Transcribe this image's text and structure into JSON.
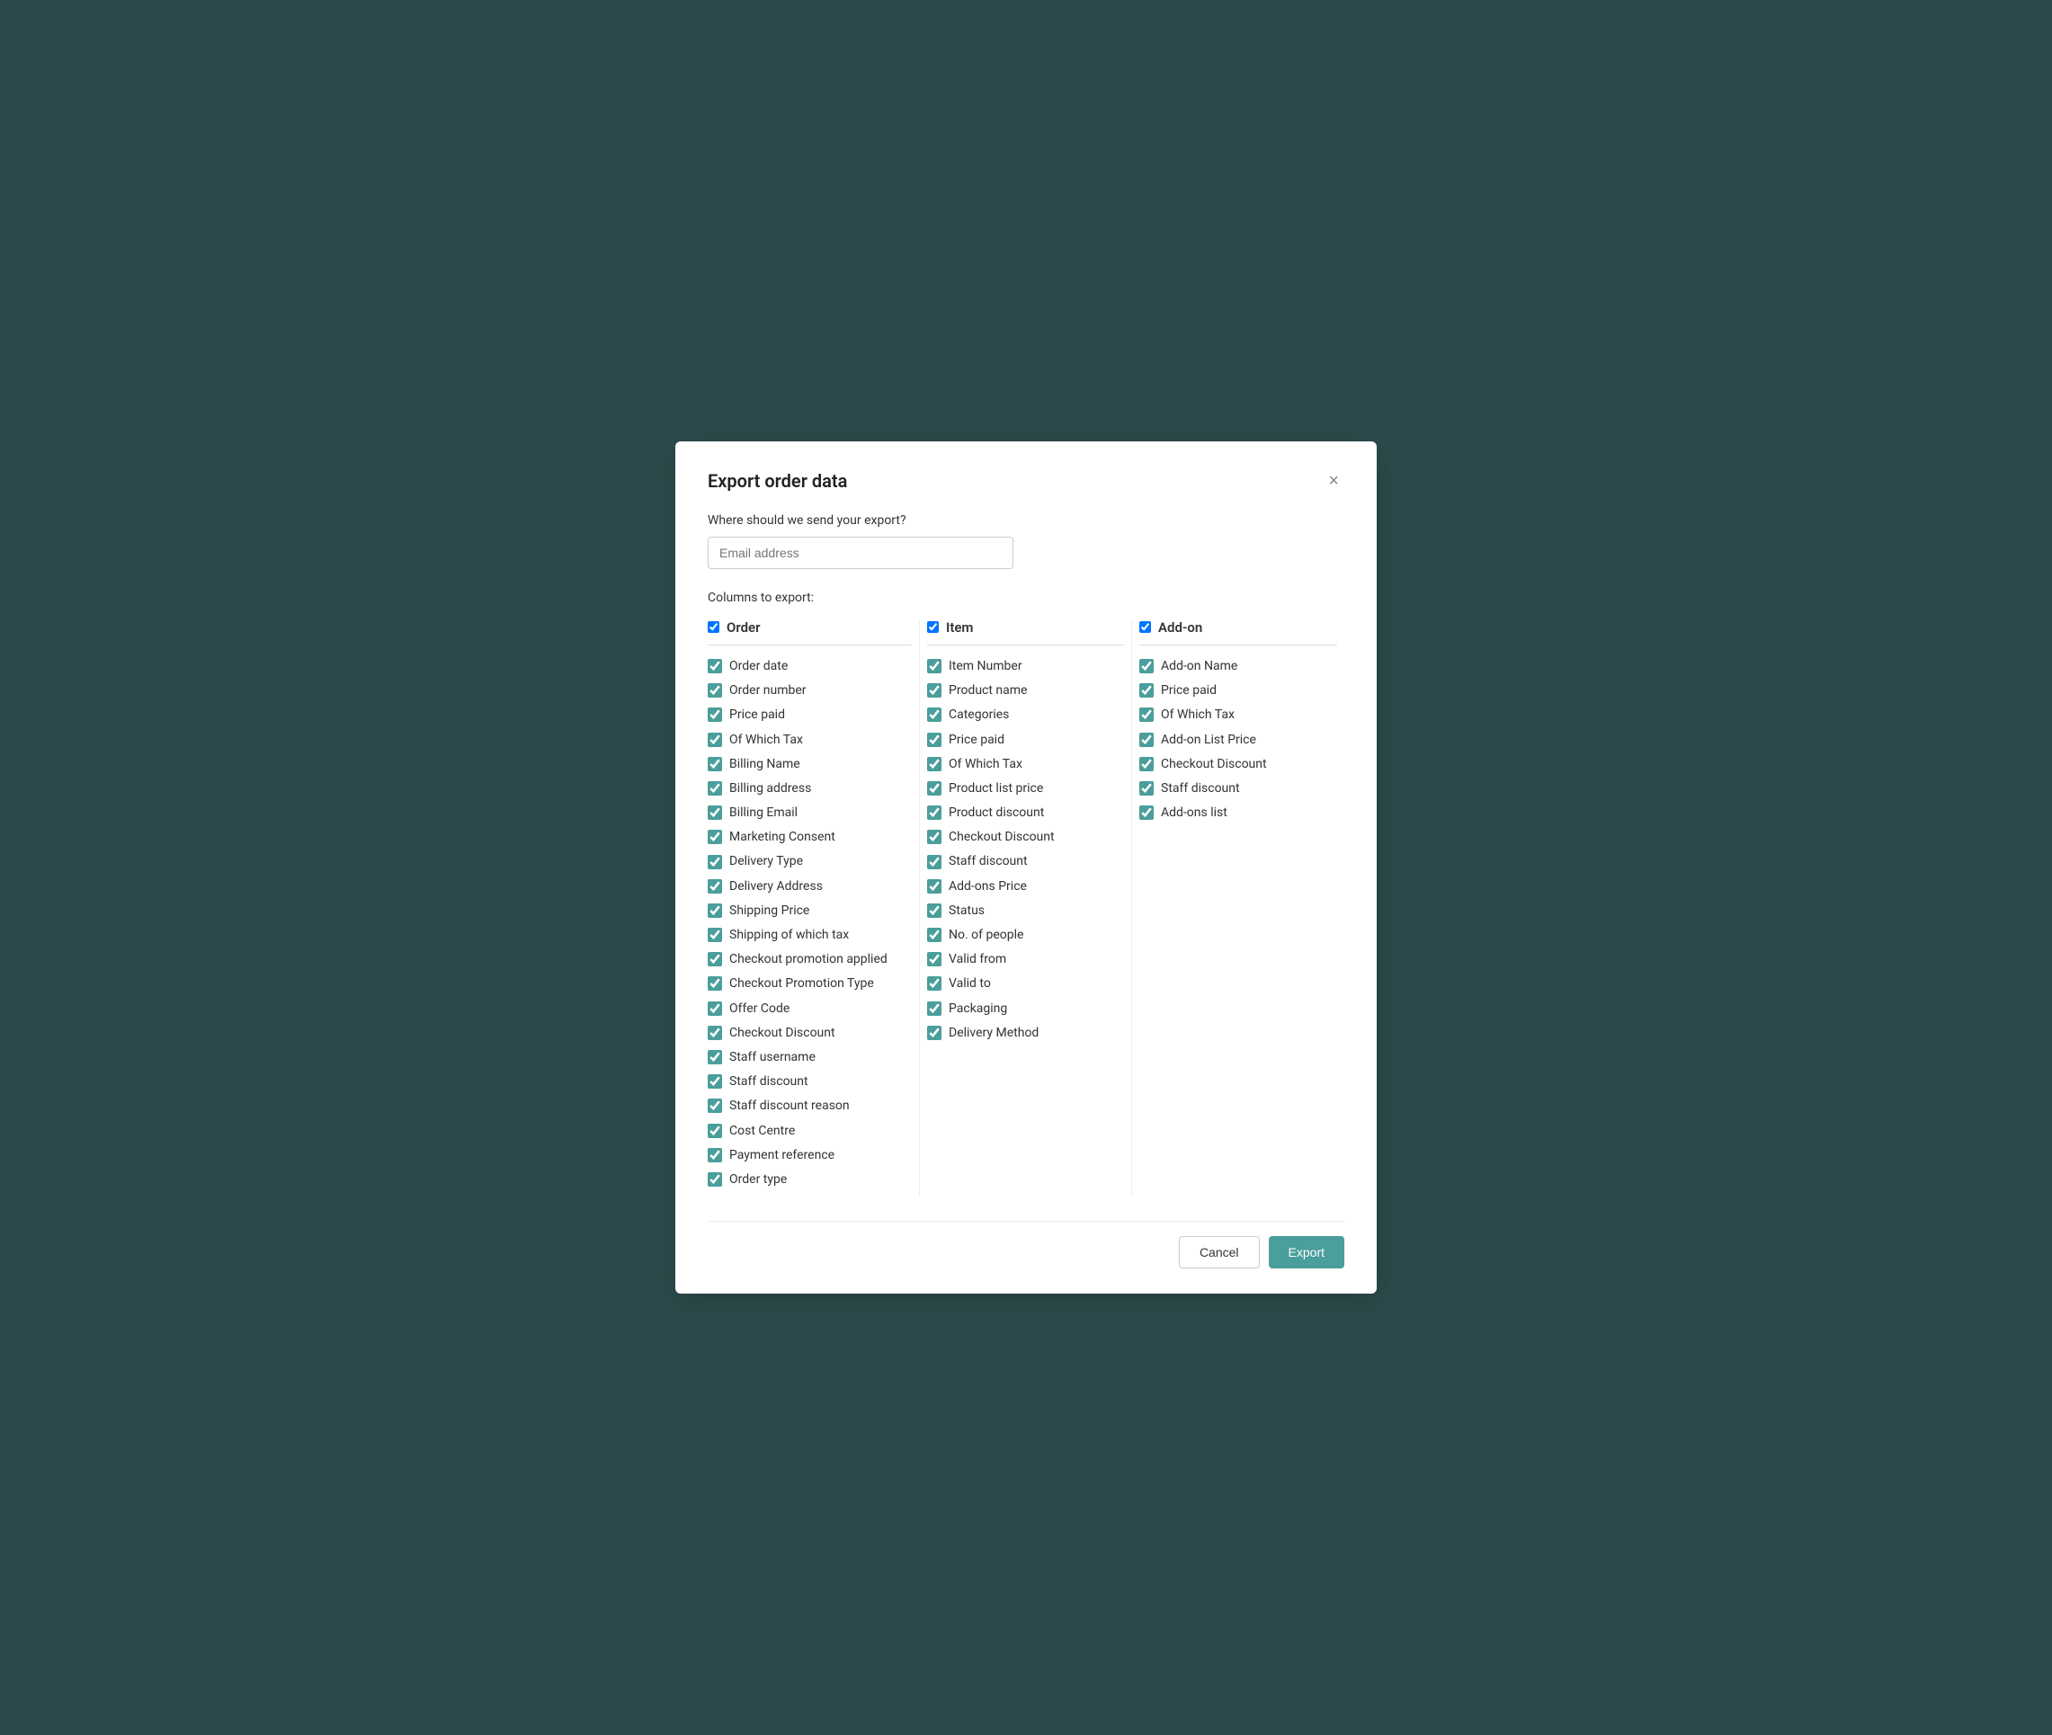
{
  "modal": {
    "title": "Export order data",
    "close_label": "×",
    "email_section": {
      "label": "Where should we send your export?",
      "input_placeholder": "Email address",
      "input_value": ""
    },
    "columns_section": {
      "label": "Columns to export:"
    },
    "columns": {
      "order": {
        "header": "Order",
        "items": [
          "Order date",
          "Order number",
          "Price paid",
          "Of Which Tax",
          "Billing Name",
          "Billing address",
          "Billing Email",
          "Marketing Consent",
          "Delivery Type",
          "Delivery Address",
          "Shipping Price",
          "Shipping of which tax",
          "Checkout promotion applied",
          "Checkout Promotion Type",
          "Offer Code",
          "Checkout Discount",
          "Staff username",
          "Staff discount",
          "Staff discount reason",
          "Cost Centre",
          "Payment reference",
          "Order type"
        ]
      },
      "item": {
        "header": "Item",
        "items": [
          "Item Number",
          "Product name",
          "Categories",
          "Price paid",
          "Of Which Tax",
          "Product list price",
          "Product discount",
          "Checkout Discount",
          "Staff discount",
          "Add-ons Price",
          "Status",
          "No. of people",
          "Valid from",
          "Valid to",
          "Packaging",
          "Delivery Method"
        ]
      },
      "addon": {
        "header": "Add-on",
        "items": [
          "Add-on Name",
          "Price paid",
          "Of Which Tax",
          "Add-on List Price",
          "Checkout Discount",
          "Staff discount",
          "Add-ons list"
        ]
      }
    },
    "footer": {
      "cancel_label": "Cancel",
      "export_label": "Export"
    }
  }
}
